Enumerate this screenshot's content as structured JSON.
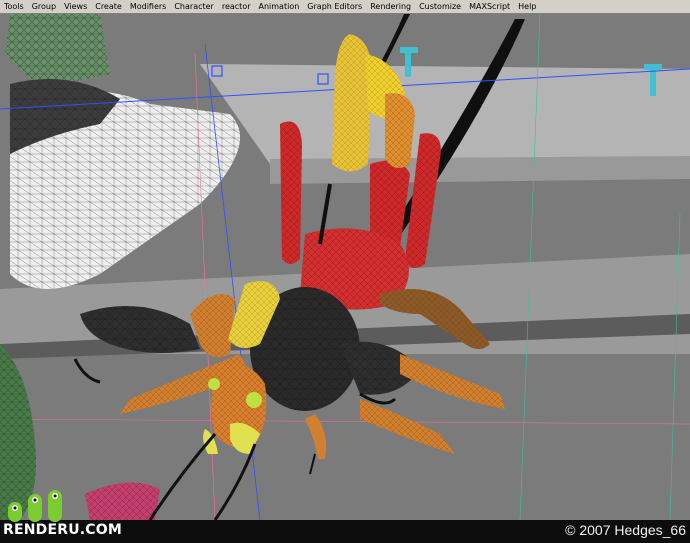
{
  "menubar": {
    "items": [
      "Tools",
      "Group",
      "Views",
      "Create",
      "Modifiers",
      "Character",
      "reactor",
      "Animation",
      "Graph Editors",
      "Rendering",
      "Customize",
      "MAXScript",
      "Help"
    ]
  },
  "viewport": {
    "subject": "wireframe insect model (cricket)",
    "colors": {
      "background": "#7a7a7a",
      "floor_light": "#b0b0b0",
      "body_dark": "#2a2a2a",
      "legs_orange": "#d08030",
      "head_red": "#d02a2a",
      "highlight_yellow": "#f0e040",
      "grid_green": "#3a6a3a"
    }
  },
  "footer": {
    "logo_text": "RENDERU.COM",
    "copyright": "© 2007 Hedges_66"
  }
}
